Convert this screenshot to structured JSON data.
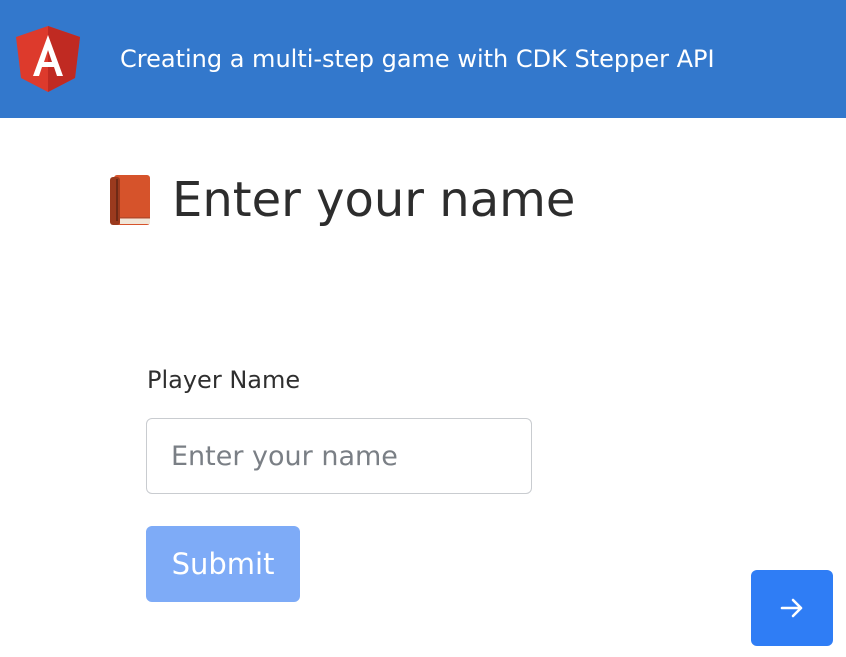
{
  "header": {
    "title": "Creating a multi-step game with CDK Stepper API",
    "logo_icon": "angular-logo-icon",
    "background_color": "#3378cc"
  },
  "step": {
    "heading_icon": "book-icon",
    "heading": "Enter your name"
  },
  "form": {
    "player_name_label": "Player Name",
    "player_name_value": "",
    "player_name_placeholder": "Enter your name",
    "submit_label": "Submit",
    "submit_color": "#7eabf7"
  },
  "navigation": {
    "next_icon": "arrow-right-icon",
    "next_color": "#2f7df5"
  }
}
